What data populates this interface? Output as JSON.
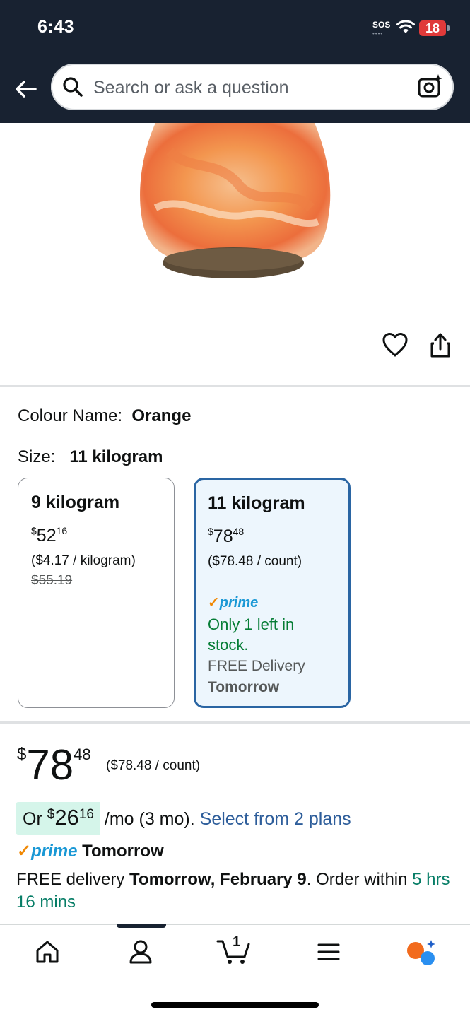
{
  "status_bar": {
    "time": "6:43",
    "sos": "SOS",
    "battery": "18"
  },
  "search": {
    "placeholder": "Search or ask a question"
  },
  "colour": {
    "label": "Colour Name:",
    "value": "Orange"
  },
  "size": {
    "label": "Size:",
    "value": "11 kilogram",
    "options": [
      {
        "title": "9 kilogram",
        "currency": "$",
        "whole": "52",
        "fraction": "16",
        "unit_price": "($4.17 / kilogram)",
        "list_price": "$55.19"
      },
      {
        "title": "11 kilogram",
        "currency": "$",
        "whole": "78",
        "fraction": "48",
        "unit_price": "($78.48 / count)",
        "prime": "prime",
        "stock": "Only 1 left in stock.",
        "delivery": "FREE Delivery",
        "delivery_when": "Tomorrow"
      }
    ]
  },
  "price": {
    "currency": "$",
    "whole": "78",
    "fraction": "48",
    "unit_price": "($78.48 / count)"
  },
  "installments": {
    "prefix": "Or",
    "currency": "$",
    "whole": "26",
    "fraction": "16",
    "suffix": "/mo (3 mo).",
    "link": "Select from 2 plans"
  },
  "prime_delivery": {
    "prime": "prime",
    "when": "Tomorrow"
  },
  "delivery": {
    "free": "FREE delivery",
    "date": "Tomorrow, February 9",
    "order_within": ". Order within",
    "countdown": "5 hrs 16 mins"
  },
  "nav": {
    "cart_count": "1"
  },
  "colors": {
    "header": "#182231",
    "selected_border": "#2a65a3",
    "prime_blue": "#1a98d5",
    "stock_green": "#067d36",
    "link": "#2d5d9a"
  }
}
